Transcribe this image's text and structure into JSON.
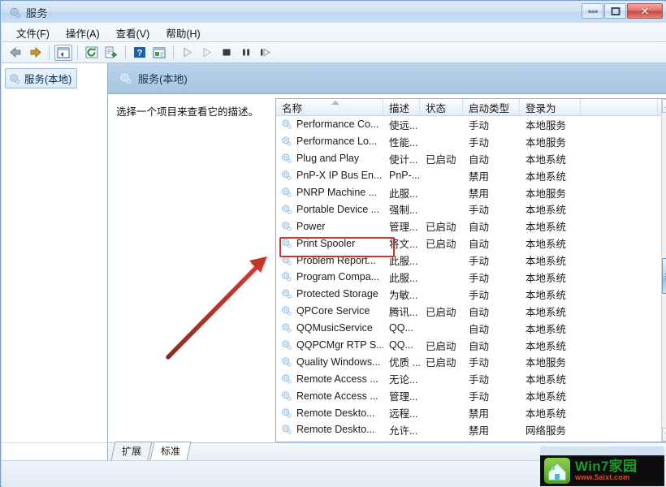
{
  "window": {
    "title": "服务",
    "icon": "services-gear-icon",
    "buttons": {
      "minimize": "最小化",
      "maximize": "最大化",
      "close": "✕"
    }
  },
  "menubar": {
    "items": [
      {
        "label": "文件(F)",
        "name": "menu-file"
      },
      {
        "label": "操作(A)",
        "name": "menu-action"
      },
      {
        "label": "查看(V)",
        "name": "menu-view"
      },
      {
        "label": "帮助(H)",
        "name": "menu-help"
      }
    ]
  },
  "toolbar": {
    "buttons": [
      {
        "name": "back-icon",
        "label": "后退"
      },
      {
        "name": "forward-icon",
        "label": "前进"
      },
      {
        "name": "show-tree-icon",
        "label": "显示/隐藏控制台树"
      },
      {
        "name": "refresh-icon",
        "label": "刷新"
      },
      {
        "name": "export-list-icon",
        "label": "导出列表"
      },
      {
        "name": "help-icon",
        "label": "帮助"
      },
      {
        "name": "properties-icon",
        "label": "属性"
      },
      {
        "name": "start-service-icon",
        "label": "启动服务"
      },
      {
        "name": "resume-service-icon",
        "label": "恢复服务"
      },
      {
        "name": "stop-service-icon",
        "label": "停止服务"
      },
      {
        "name": "pause-service-icon",
        "label": "暂停服务"
      },
      {
        "name": "restart-service-icon",
        "label": "重启服务"
      }
    ]
  },
  "tree": {
    "node_label": "服务(本地)",
    "node_icon": "services-gear-icon"
  },
  "content_header": {
    "title": "服务(本地)",
    "icon": "services-gear-icon"
  },
  "description_pane": {
    "text": "选择一个项目来查看它的描述。"
  },
  "list": {
    "columns": [
      {
        "label": "名称",
        "width": 132,
        "sorted": "asc"
      },
      {
        "label": "描述",
        "width": 45
      },
      {
        "label": "状态",
        "width": 53
      },
      {
        "label": "启动类型",
        "width": 70
      },
      {
        "label": "登录为",
        "width": 75
      },
      {
        "label": "",
        "width": 95
      }
    ],
    "rows": [
      {
        "name": "Performance Co...",
        "desc": "使远...",
        "status": "",
        "startup": "手动",
        "logon": "本地服务"
      },
      {
        "name": "Performance Lo...",
        "desc": "性能...",
        "status": "",
        "startup": "手动",
        "logon": "本地服务"
      },
      {
        "name": "Plug and Play",
        "desc": "使计...",
        "status": "已启动",
        "startup": "自动",
        "logon": "本地系统"
      },
      {
        "name": "PnP-X IP Bus En...",
        "desc": "PnP-...",
        "status": "",
        "startup": "禁用",
        "logon": "本地系统"
      },
      {
        "name": "PNRP Machine ...",
        "desc": "此服...",
        "status": "",
        "startup": "禁用",
        "logon": "本地服务"
      },
      {
        "name": "Portable Device ...",
        "desc": "强制...",
        "status": "",
        "startup": "手动",
        "logon": "本地系统"
      },
      {
        "name": "Power",
        "desc": "管理...",
        "status": "已启动",
        "startup": "自动",
        "logon": "本地系统"
      },
      {
        "name": "Print Spooler",
        "desc": "将文...",
        "status": "已启动",
        "startup": "自动",
        "logon": "本地系统",
        "highlighted": true
      },
      {
        "name": "Problem Report...",
        "desc": "此服...",
        "status": "",
        "startup": "手动",
        "logon": "本地系统"
      },
      {
        "name": "Program Compa...",
        "desc": "此服...",
        "status": "",
        "startup": "手动",
        "logon": "本地系统"
      },
      {
        "name": "Protected Storage",
        "desc": "为敏...",
        "status": "",
        "startup": "手动",
        "logon": "本地系统"
      },
      {
        "name": "QPCore Service",
        "desc": "腾讯...",
        "status": "已启动",
        "startup": "自动",
        "logon": "本地系统"
      },
      {
        "name": "QQMusicService",
        "desc": "QQ...",
        "status": "",
        "startup": "自动",
        "logon": "本地系统"
      },
      {
        "name": "QQPCMgr RTP S...",
        "desc": "QQ...",
        "status": "已启动",
        "startup": "自动",
        "logon": "本地系统"
      },
      {
        "name": "Quality Windows...",
        "desc": "优质 ...",
        "status": "已启动",
        "startup": "手动",
        "logon": "本地服务"
      },
      {
        "name": "Remote Access ...",
        "desc": "无论...",
        "status": "",
        "startup": "手动",
        "logon": "本地系统"
      },
      {
        "name": "Remote Access ...",
        "desc": "管理...",
        "status": "",
        "startup": "手动",
        "logon": "本地系统"
      },
      {
        "name": "Remote Deskto...",
        "desc": "远程...",
        "status": "",
        "startup": "禁用",
        "logon": "本地系统"
      },
      {
        "name": "Remote Deskto...",
        "desc": "允许...",
        "status": "",
        "startup": "禁用",
        "logon": "网络服务"
      }
    ]
  },
  "tabs": [
    {
      "label": "扩展",
      "active": false,
      "name": "tab-extended"
    },
    {
      "label": "标准",
      "active": true,
      "name": "tab-standard"
    }
  ],
  "annotation": {
    "arrow_color": "#c0392b",
    "highlight_color": "#c0392b",
    "target": "Print Spooler"
  },
  "watermark": {
    "title": "Win7家园",
    "url": "www.5aixt.com"
  }
}
